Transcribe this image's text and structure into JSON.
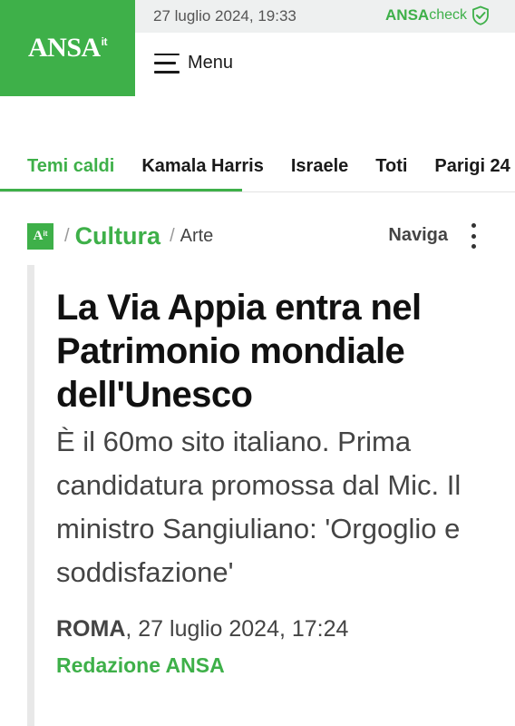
{
  "header": {
    "logo_text": "ANSA",
    "logo_suffix": "it",
    "datetime": "27 luglio 2024, 19:33",
    "check_brand": "ANSA",
    "check_word": "check",
    "menu_label": "Menu",
    "brand_color": "#3eb049"
  },
  "topics": {
    "items": [
      "Temi caldi",
      "Kamala Harris",
      "Israele",
      "Toti",
      "Parigi 24"
    ],
    "scroll_progress": 0.47
  },
  "breadcrumb": {
    "mini_logo": "A",
    "mini_logo_suffix": "it",
    "separator": "/",
    "section": "Cultura",
    "subsection": "Arte",
    "navigate_label": "Naviga"
  },
  "article": {
    "title": "La Via Appia entra nel Patrimonio mondiale dell'Unesco",
    "subtitle": "È il 60mo sito italiano. Prima candidatura promossa dal Mic. Il ministro Sangiuliano: 'Orgoglio e soddisfazione'",
    "place": "ROMA",
    "date": ", 27 luglio 2024, 17:24",
    "author": "Redazione ANSA"
  },
  "icons": [
    "hamburger-icon",
    "shield-check-icon",
    "kebab-menu-icon"
  ]
}
